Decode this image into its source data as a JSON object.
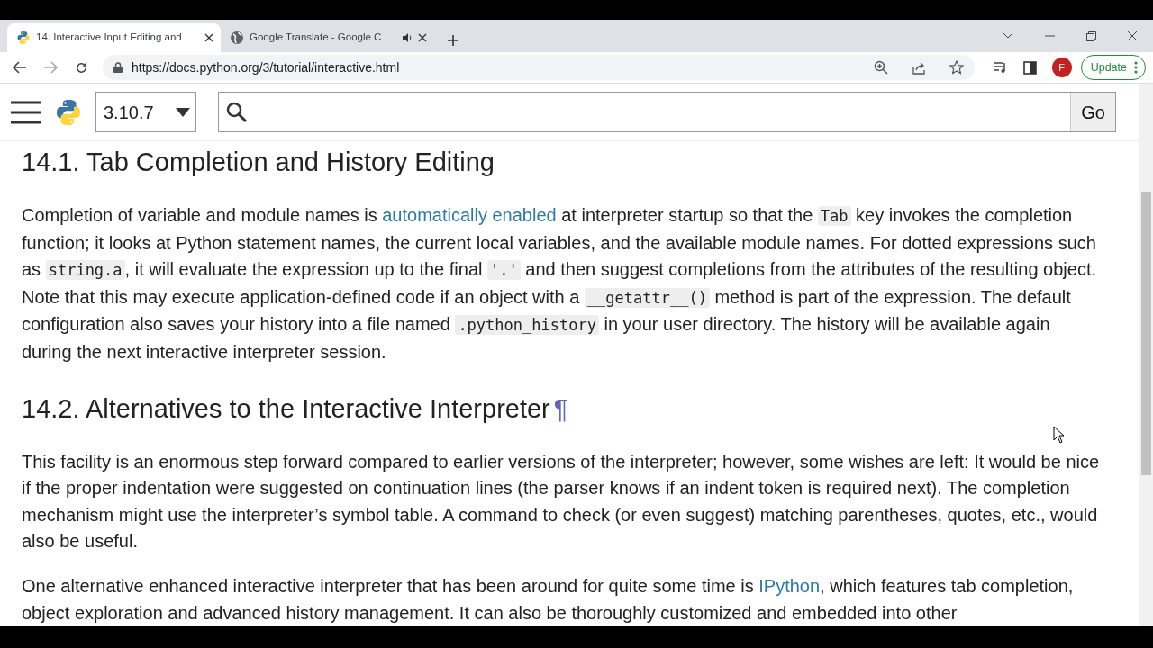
{
  "browser": {
    "tabs": [
      {
        "title": "14. Interactive Input Editing and",
        "selected": true,
        "kind": "python",
        "audio": false
      },
      {
        "title": "Google Translate - Google C",
        "selected": false,
        "kind": "globe",
        "audio": true
      }
    ],
    "url": "https://docs.python.org/3/tutorial/interactive.html",
    "profile_initial": "F",
    "update_label": "Update"
  },
  "header": {
    "version": "3.10.7",
    "go_label": "Go"
  },
  "sections": [
    {
      "title": "14.1. Tab Completion and History Editing",
      "paragraphs": [
        [
          {
            "kind": "text",
            "text": "Completion of variable and module names is "
          },
          {
            "kind": "link",
            "text": "automatically enabled"
          },
          {
            "kind": "text",
            "text": " at interpreter startup so that the "
          },
          {
            "kind": "code",
            "text": "Tab"
          },
          {
            "kind": "text",
            "text": " key invokes the completion function; it looks at Python statement names, the current local variables, and the available module names. For dotted expressions such as "
          },
          {
            "kind": "code",
            "text": "string.a"
          },
          {
            "kind": "text",
            "text": ", it will evaluate the expression up to the final "
          },
          {
            "kind": "code",
            "text": "'.'"
          },
          {
            "kind": "text",
            "text": " and then suggest completions from the attributes of the resulting object. Note that this may execute application-defined code if an object with a "
          },
          {
            "kind": "code",
            "text": "__getattr__()"
          },
          {
            "kind": "text",
            "text": " method is part of the expression. The default configuration also saves your history into a file named "
          },
          {
            "kind": "code",
            "text": ".python_history"
          },
          {
            "kind": "text",
            "text": " in your user directory. The history will be available again during the next interactive interpreter session."
          }
        ]
      ]
    },
    {
      "title": "14.2. Alternatives to the Interactive Interpreter",
      "anchor": "¶",
      "paragraphs": [
        [
          {
            "kind": "text",
            "text": "This facility is an enormous step forward compared to earlier versions of the interpreter; however, some wishes are left: It would be nice if the proper indentation were suggested on continuation lines (the parser knows if an indent token is required next). The completion mechanism might use the interpreter’s symbol table. A command to check (or even suggest) matching parentheses, quotes, etc., would also be useful."
          }
        ],
        [
          {
            "kind": "text",
            "text": "One alternative enhanced interactive interpreter that has been around for quite some time is "
          },
          {
            "kind": "link",
            "text": "IPython"
          },
          {
            "kind": "text",
            "text": ", which features tab completion, object exploration and advanced history management. It can also be thoroughly customized and embedded into other"
          }
        ]
      ]
    }
  ]
}
